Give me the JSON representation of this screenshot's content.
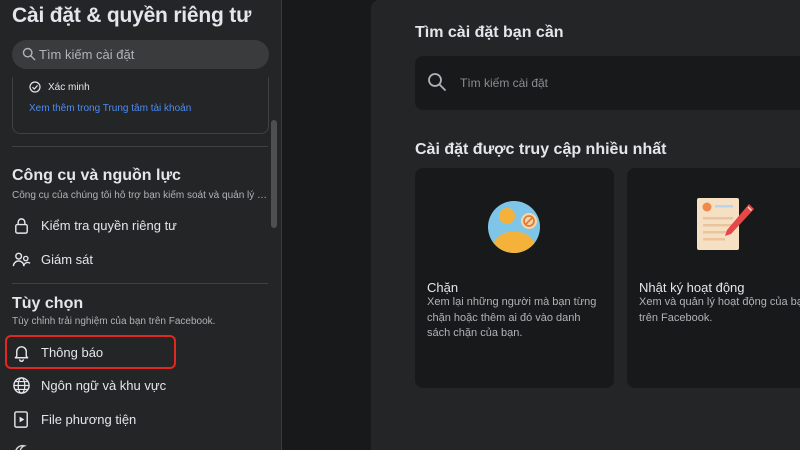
{
  "sidebar": {
    "title": "Cài đặt & quyền riêng tư",
    "search_placeholder": "Tìm kiếm cài đặt",
    "account": {
      "verify_label": "Xác minh",
      "more_link": "Xem thêm trong Trung tâm tài khoản"
    },
    "tools": {
      "title": "Công cụ và nguồn lực",
      "description": "Công cụ của chúng tôi hỗ trợ bạn kiểm soát và quản lý quyền riêng tư của mình.",
      "items": [
        {
          "label": "Kiểm tra quyền riêng tư",
          "icon": "lock-icon"
        },
        {
          "label": "Giám sát",
          "icon": "supervision-icon"
        }
      ]
    },
    "preferences": {
      "title": "Tùy chọn",
      "description": "Tùy chỉnh trải nghiệm của bạn trên Facebook.",
      "items": [
        {
          "label": "Thông báo",
          "icon": "bell-icon",
          "highlighted": true
        },
        {
          "label": "Ngôn ngữ và khu vực",
          "icon": "globe-icon"
        },
        {
          "label": "File phương tiện",
          "icon": "media-icon"
        }
      ]
    }
  },
  "main": {
    "search_heading": "Tìm cài đặt bạn cần",
    "search_placeholder": "Tìm kiếm cài đặt",
    "frequent_heading": "Cài đặt được truy cập nhiều nhất",
    "cards": [
      {
        "title": "Chặn",
        "description": "Xem lại những người mà bạn từng\nchặn hoặc thêm ai đó vào danh\nsách chặn của bạn.",
        "icon": "blocking-illustration"
      },
      {
        "title": "Nhật ký hoạt động",
        "description": "Xem và quản lý hoạt động của bạn\ntrên Facebook.",
        "icon": "activity-log-illustration"
      }
    ]
  },
  "colors": {
    "background": "#18191a",
    "surface": "#242526",
    "link": "#4c8cf5",
    "highlight_border": "#e0281e"
  }
}
